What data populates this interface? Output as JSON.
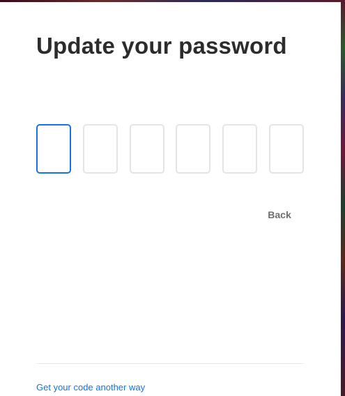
{
  "page": {
    "title": "Update your password"
  },
  "code_entry": {
    "digits": [
      "",
      "",
      "",
      "",
      "",
      ""
    ],
    "focused_index": 0
  },
  "actions": {
    "back_label": "Back",
    "alt_code_link": "Get your code another way"
  },
  "colors": {
    "accent": "#1473e6",
    "title_text": "#2c2c2c",
    "box_border": "#e4e4e4",
    "back_text": "#6e6e6e",
    "divider": "#e8e8e8"
  }
}
